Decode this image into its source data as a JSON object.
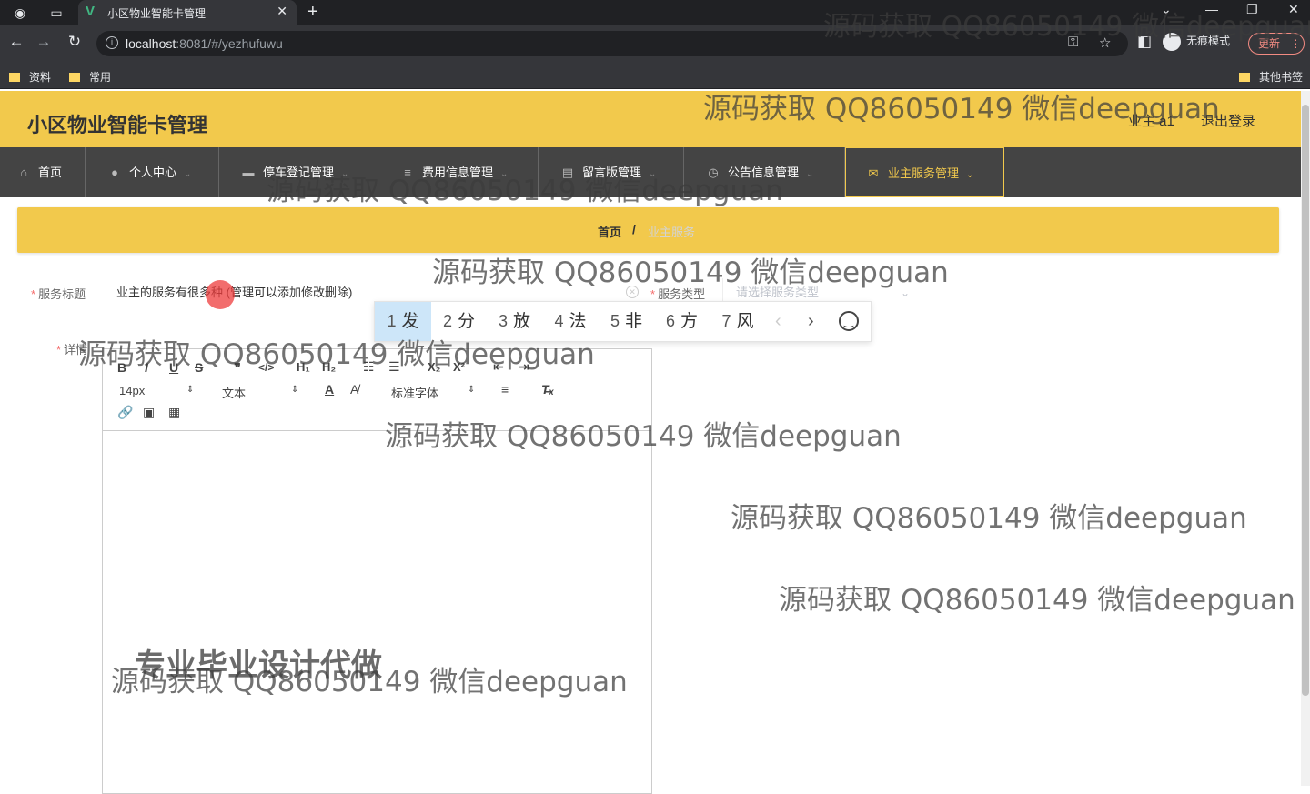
{
  "browser": {
    "tab_title": "小区物业智能卡管理",
    "url_host": "localhost",
    "url_rest": ":8081/#/yezhufuwu",
    "incognito_label": "无痕模式",
    "update_label": "更新",
    "bookmarks": [
      "资料",
      "常用"
    ],
    "other_bookmarks": "其他书签"
  },
  "header": {
    "title": "小区物业智能卡管理",
    "user": "业主 a1",
    "logout": "退出登录"
  },
  "menu": [
    {
      "label": "首页",
      "icon": "home-icon"
    },
    {
      "label": "个人中心",
      "icon": "user-icon"
    },
    {
      "label": "停车登记管理",
      "icon": "briefcase-icon"
    },
    {
      "label": "费用信息管理",
      "icon": "list-icon"
    },
    {
      "label": "留言版管理",
      "icon": "document-icon"
    },
    {
      "label": "公告信息管理",
      "icon": "clock-icon"
    },
    {
      "label": "业主服务管理",
      "icon": "mail-icon"
    }
  ],
  "breadcrumb": {
    "home": "首页",
    "separator": "/",
    "current": "业主服务"
  },
  "form": {
    "title_label": "服务标题",
    "title_value": "业主的服务有很多种 (管理可以添加修改删除)",
    "type_label": "服务类型",
    "type_placeholder": "请选择服务类型",
    "detail_label": "详情"
  },
  "ime": {
    "candidates": [
      {
        "num": "1",
        "char": "发"
      },
      {
        "num": "2",
        "char": "分"
      },
      {
        "num": "3",
        "char": "放"
      },
      {
        "num": "4",
        "char": "法"
      },
      {
        "num": "5",
        "char": "非"
      },
      {
        "num": "6",
        "char": "方"
      },
      {
        "num": "7",
        "char": "风"
      }
    ]
  },
  "editor": {
    "font_size": "14px",
    "text_style": "文本",
    "font_family": "标准字体",
    "overlay_text": "专业毕业设计代做"
  },
  "watermark": "源码获取 QQ86050149 微信deepguan",
  "colors": {
    "accent": "#f2c94c",
    "menu_bg": "#444444",
    "ime_selected": "#cde6f9"
  }
}
